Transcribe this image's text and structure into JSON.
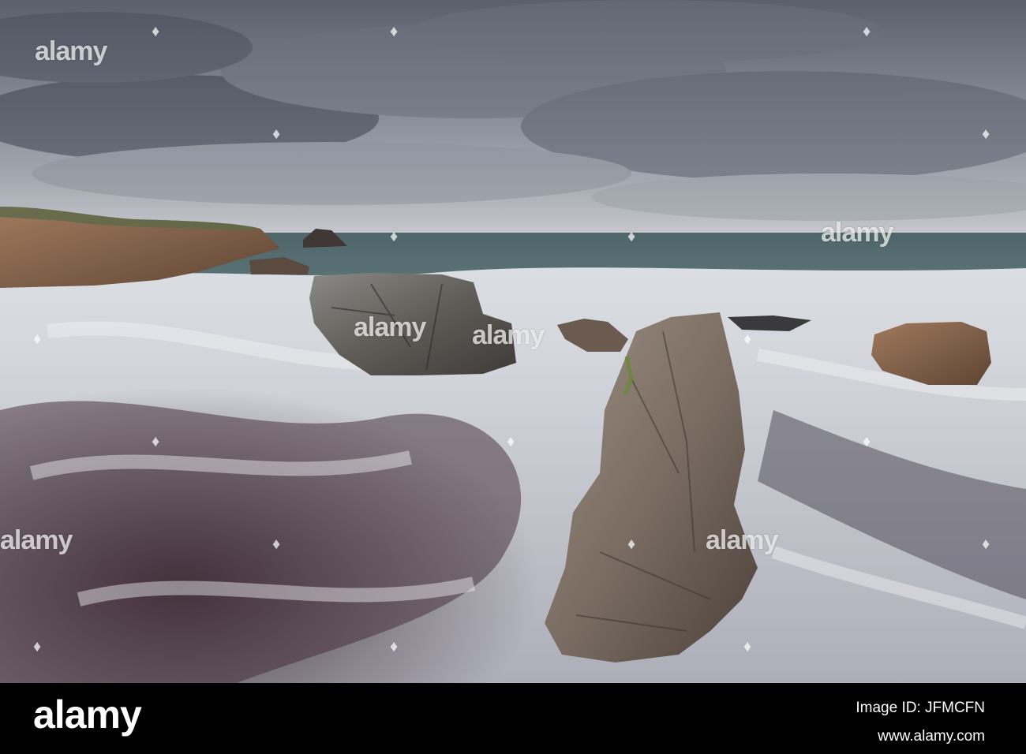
{
  "photo": {
    "subject": "stormy seascape"
  },
  "watermark": {
    "brand": "alamy"
  },
  "footer": {
    "brand": "alamy",
    "image_id": "Image ID: JFMCFN",
    "url": "www.alamy.com"
  }
}
